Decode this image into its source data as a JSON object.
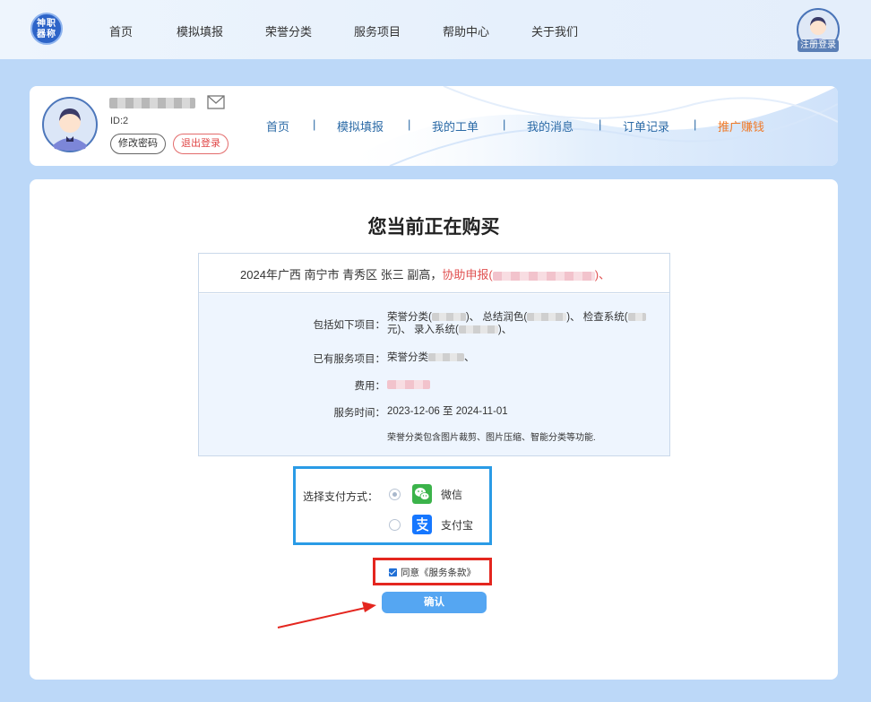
{
  "topbar": {
    "logo_text": "神职器称",
    "nav": [
      "首页",
      "模拟填报",
      "荣誉分类",
      "服务项目",
      "帮助中心",
      "关于我们"
    ],
    "register_label": "注册登录"
  },
  "user": {
    "id_text": "ID:2",
    "change_password": "修改密码",
    "logout": "退出登录",
    "nav": [
      "首页",
      "模拟填报",
      "我的工单",
      "我的消息",
      "订单记录",
      "推广赚钱"
    ],
    "separator": "|"
  },
  "order": {
    "title": "您当前正在购买",
    "head_prefix": "2024年广西 南宁市 青秀区 张三 副高，",
    "head_highlight": "协助申报(",
    "head_suffix": ")、",
    "items_label": "包括如下项目：",
    "items_value_1": "荣誉分类(",
    "items_value_2": ")、 总结润色(",
    "items_value_3": ")、 检查系统(",
    "items_value_4": "元)、 录入系统(",
    "items_value_5": ")、",
    "existing_label": "已有服务项目：",
    "existing_value": "荣誉分类",
    "existing_suffix": "、",
    "fee_label": "费用：",
    "period_label": "服务时间：",
    "period_value": "2023-12-06 至 2024-11-01",
    "note": "荣誉分类包含图片裁剪、图片压缩、智能分类等功能."
  },
  "payment": {
    "label": "选择支付方式：",
    "options": [
      {
        "name": "微信",
        "icon": "wechat-icon",
        "selected": true,
        "color": "#3bb34a"
      },
      {
        "name": "支付宝",
        "icon": "alipay-icon",
        "selected": false,
        "color": "#1677ff"
      }
    ]
  },
  "agree": {
    "checked": true,
    "text": "同意《服务条款》"
  },
  "confirm_label": "确认",
  "colors": {
    "accent": "#55a6f2",
    "highlight_red": "#e4261f",
    "highlight_blue": "#2a9be6",
    "promo": "#f07a28"
  }
}
